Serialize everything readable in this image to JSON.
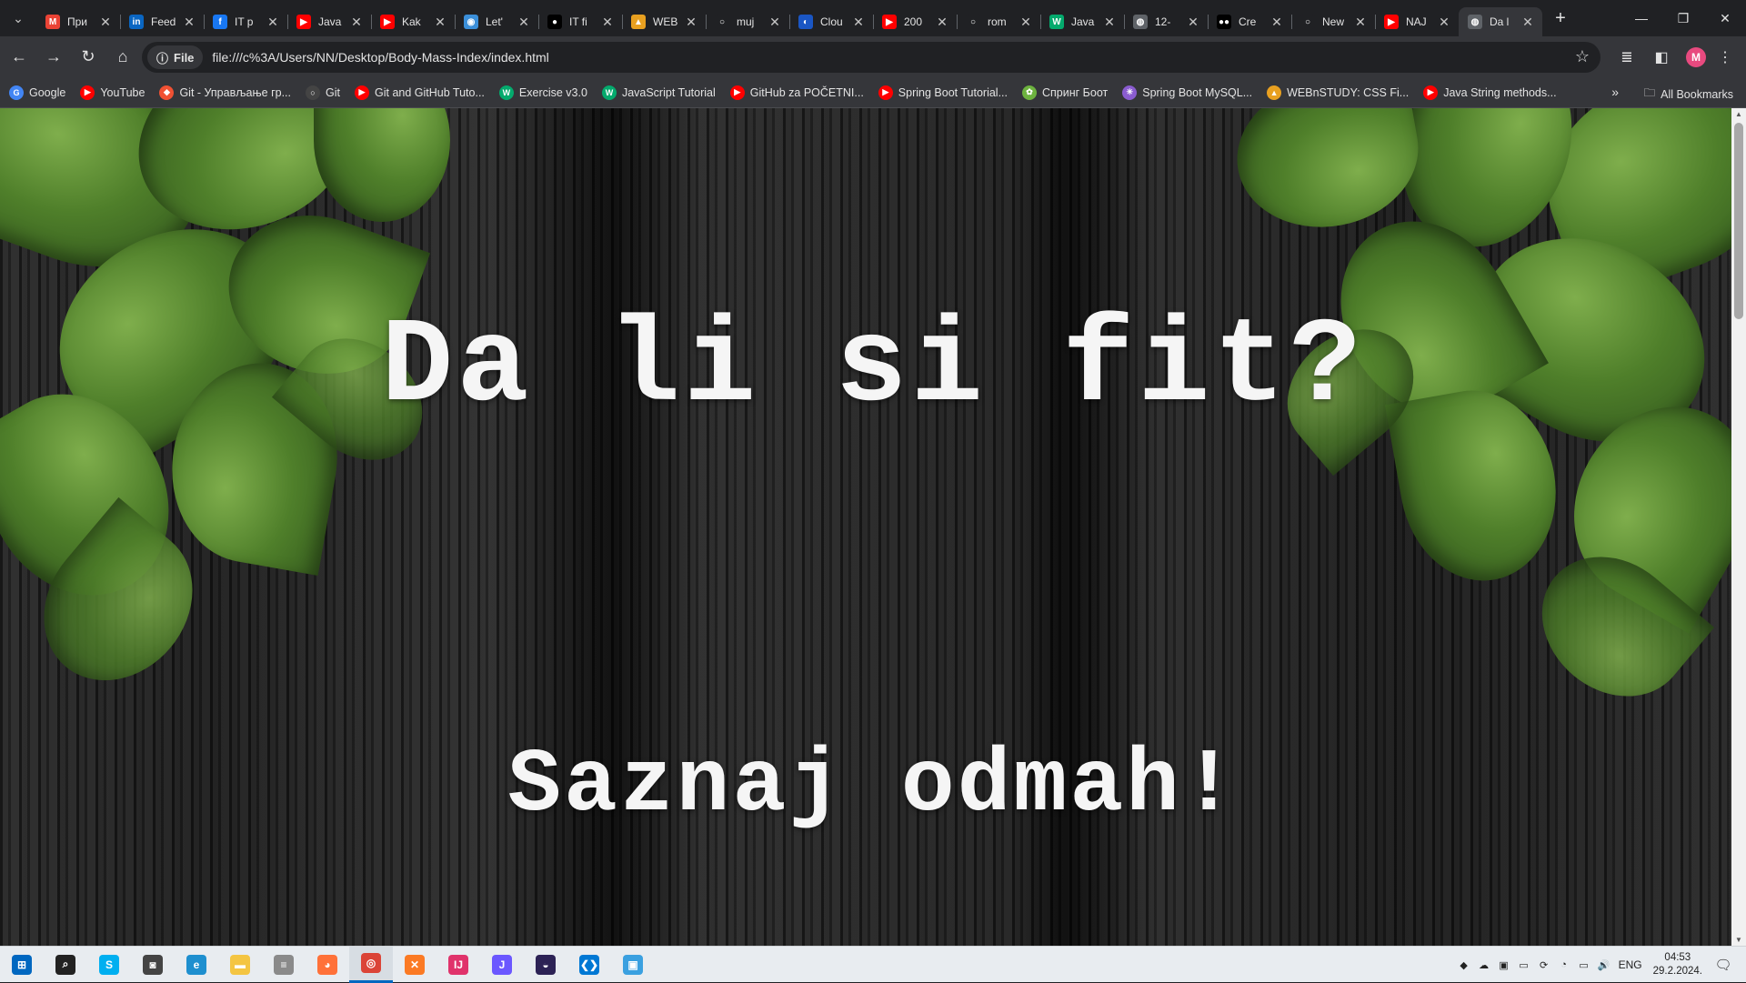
{
  "browser": {
    "tabs": [
      {
        "title": "При",
        "icon": "gmail-icon",
        "color": "#ea4335",
        "glyph": "M"
      },
      {
        "title": "Feed",
        "icon": "linkedin-icon",
        "color": "#0a66c2",
        "glyph": "in"
      },
      {
        "title": "IT p",
        "icon": "facebook-icon",
        "color": "#1877f2",
        "glyph": "f"
      },
      {
        "title": "Java",
        "icon": "youtube-icon",
        "color": "#ff0000",
        "glyph": "▶"
      },
      {
        "title": "Kak",
        "icon": "youtube-icon",
        "color": "#ff0000",
        "glyph": "▶"
      },
      {
        "title": "Let'",
        "icon": "globe-icon",
        "color": "#3b8fd9",
        "glyph": "◉"
      },
      {
        "title": "IT fi",
        "icon": "dark-site-icon",
        "color": "#000000",
        "glyph": "●"
      },
      {
        "title": "WEB",
        "icon": "hat-icon",
        "color": "#e8a020",
        "glyph": "▲"
      },
      {
        "title": "muj",
        "icon": "github-icon",
        "color": "#202124",
        "glyph": "○"
      },
      {
        "title": "Clou",
        "icon": "cloud-icon",
        "color": "#1a56c4",
        "glyph": "◐"
      },
      {
        "title": "200",
        "icon": "youtube-icon",
        "color": "#ff0000",
        "glyph": "▶"
      },
      {
        "title": "rom",
        "icon": "github-icon",
        "color": "#202124",
        "glyph": "○"
      },
      {
        "title": "Java",
        "icon": "w3-icon",
        "color": "#04aa6d",
        "glyph": "W"
      },
      {
        "title": "12-",
        "icon": "globe-icon",
        "color": "#5f6368",
        "glyph": "◍"
      },
      {
        "title": "Cre",
        "icon": "medium-icon",
        "color": "#000000",
        "glyph": "●●"
      },
      {
        "title": "New",
        "icon": "github-icon",
        "color": "#202124",
        "glyph": "○"
      },
      {
        "title": "NAJ",
        "icon": "youtube-icon",
        "color": "#ff0000",
        "glyph": "▶"
      },
      {
        "title": "Da l",
        "icon": "globe-icon",
        "color": "#5f6368",
        "glyph": "◍",
        "active": true
      }
    ],
    "new_tab": "+",
    "url_chip": "File",
    "url": "file:///c%3A/Users/NN/Desktop/Body-Mass-Index/index.html",
    "avatar_letter": "M",
    "bookmarks": [
      {
        "label": "Google",
        "icon": "google-icon",
        "color": "#4285f4",
        "glyph": "G"
      },
      {
        "label": "YouTube",
        "icon": "youtube-icon",
        "color": "#ff0000",
        "glyph": "▶"
      },
      {
        "label": "Git - Управљање гр...",
        "icon": "git-icon",
        "color": "#f05133",
        "glyph": "◆"
      },
      {
        "label": "Git",
        "icon": "github-icon",
        "color": "#444",
        "glyph": "○"
      },
      {
        "label": "Git and GitHub Tuto...",
        "icon": "youtube-icon",
        "color": "#ff0000",
        "glyph": "▶"
      },
      {
        "label": "Exercise v3.0",
        "icon": "w3-icon",
        "color": "#04aa6d",
        "glyph": "W"
      },
      {
        "label": "JavaScript Tutorial",
        "icon": "w3-icon",
        "color": "#04aa6d",
        "glyph": "W"
      },
      {
        "label": "GitHub za POČETNI...",
        "icon": "youtube-icon",
        "color": "#ff0000",
        "glyph": "▶"
      },
      {
        "label": "Spring Boot Tutorial...",
        "icon": "youtube-icon",
        "color": "#ff0000",
        "glyph": "▶"
      },
      {
        "label": "Спринг Боот",
        "icon": "spring-icon",
        "color": "#6db33f",
        "glyph": "✿"
      },
      {
        "label": "Spring Boot MySQL...",
        "icon": "spark-icon",
        "color": "#8a5cd0",
        "glyph": "✳"
      },
      {
        "label": "WEBnSTUDY: CSS Fi...",
        "icon": "hat-icon",
        "color": "#e8a020",
        "glyph": "▲"
      },
      {
        "label": "Java String methods...",
        "icon": "youtube-icon",
        "color": "#ff0000",
        "glyph": "▶"
      }
    ],
    "more_bookmarks": "»",
    "all_bookmarks": "All Bookmarks"
  },
  "page": {
    "title": "Da li si fit?",
    "subtitle": "Saznaj odmah!"
  },
  "taskbar": {
    "apps": [
      {
        "icon": "windows-start-icon",
        "color": "#0067c0",
        "glyph": "⊞"
      },
      {
        "icon": "search-icon",
        "color": "#222",
        "glyph": "⌕"
      },
      {
        "icon": "skype-icon",
        "color": "#00aff0",
        "glyph": "S"
      },
      {
        "icon": "camera-icon",
        "color": "#444",
        "glyph": "◙"
      },
      {
        "icon": "edge-icon",
        "color": "#1e8fcf",
        "glyph": "e"
      },
      {
        "icon": "file-explorer-icon",
        "color": "#f4c542",
        "glyph": "▬"
      },
      {
        "icon": "database-icon",
        "color": "#8a8a8a",
        "glyph": "≡"
      },
      {
        "icon": "firefox-icon",
        "color": "#ff7139",
        "glyph": "◕"
      },
      {
        "icon": "chrome-icon",
        "color": "#db4437",
        "glyph": "◎",
        "active": true
      },
      {
        "icon": "xampp-icon",
        "color": "#fb7a24",
        "glyph": "✕"
      },
      {
        "icon": "intellij-icon",
        "color": "#e0336b",
        "glyph": "IJ"
      },
      {
        "icon": "jetbrains-icon",
        "color": "#6b57ff",
        "glyph": "J"
      },
      {
        "icon": "eclipse-icon",
        "color": "#2c2255",
        "glyph": "◒"
      },
      {
        "icon": "vscode-icon",
        "color": "#0078d4",
        "glyph": "❮❯"
      },
      {
        "icon": "remote-desktop-icon",
        "color": "#3aa0e0",
        "glyph": "▣"
      }
    ],
    "tray_icons": [
      "colorful-app-icon",
      "cloud-off-icon",
      "nvidia-icon",
      "display-icon",
      "sync-icon",
      "wifi-icon",
      "network-icon",
      "volume-icon"
    ],
    "language": "ENG",
    "time": "04:53",
    "date": "29.2.2024."
  }
}
